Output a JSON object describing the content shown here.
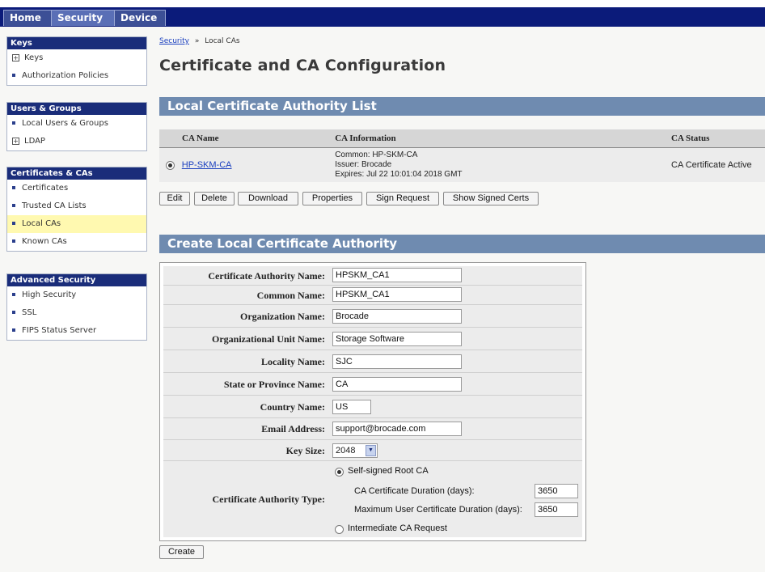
{
  "tabs": [
    {
      "label": "Home"
    },
    {
      "label": "Security"
    },
    {
      "label": "Device"
    }
  ],
  "sidebar": {
    "keys": {
      "heading": "Keys",
      "items": [
        {
          "label": "Keys",
          "marker": "plus"
        },
        {
          "label": "Authorization Policies",
          "marker": "bullet"
        }
      ]
    },
    "users_groups": {
      "heading": "Users & Groups",
      "items": [
        {
          "label": "Local Users & Groups",
          "marker": "bullet"
        },
        {
          "label": "LDAP",
          "marker": "plus"
        }
      ]
    },
    "certificates": {
      "heading": "Certificates & CAs",
      "items": [
        {
          "label": "Certificates",
          "marker": "bullet"
        },
        {
          "label": "Trusted CA Lists",
          "marker": "bullet"
        },
        {
          "label": "Local CAs",
          "marker": "bullet",
          "selected": true
        },
        {
          "label": "Known CAs",
          "marker": "bullet"
        }
      ]
    },
    "advanced": {
      "heading": "Advanced Security",
      "items": [
        {
          "label": "High Security",
          "marker": "bullet"
        },
        {
          "label": "SSL",
          "marker": "bullet"
        },
        {
          "label": "FIPS Status Server",
          "marker": "bullet"
        }
      ]
    }
  },
  "breadcrumb": {
    "link": "Security",
    "separator": "»",
    "current": "Local CAs"
  },
  "page_title": "Certificate and CA Configuration",
  "ca_list": {
    "heading": "Local Certificate Authority List",
    "columns": [
      "CA Name",
      "CA Information",
      "CA Status"
    ],
    "rows": [
      {
        "name": "HP-SKM-CA",
        "info_common": "Common: HP-SKM-CA",
        "info_issuer": "Issuer: Brocade",
        "info_expires": "Expires: Jul 22 10:01:04 2018 GMT",
        "status": "CA Certificate Active"
      }
    ],
    "buttons": [
      "Edit",
      "Delete",
      "Download",
      "Properties",
      "Sign Request",
      "Show Signed Certs"
    ]
  },
  "create_form": {
    "heading": "Create Local Certificate Authority",
    "fields": {
      "ca_name": {
        "label": "Certificate Authority Name:",
        "value": "HPSKM_CA1"
      },
      "common_name": {
        "label": "Common Name:",
        "value": "HPSKM_CA1"
      },
      "org_name": {
        "label": "Organization Name:",
        "value": "Brocade"
      },
      "org_unit": {
        "label": "Organizational Unit Name:",
        "value": "Storage Software"
      },
      "locality": {
        "label": "Locality Name:",
        "value": "SJC"
      },
      "state": {
        "label": "State or Province Name:",
        "value": "CA"
      },
      "country": {
        "label": "Country Name:",
        "value": "US"
      },
      "email": {
        "label": "Email Address:",
        "value": "support@brocade.com"
      },
      "key_size": {
        "label": "Key Size:",
        "value": "2048"
      }
    },
    "ca_type": {
      "label": "Certificate Authority Type:",
      "option_self_signed": "Self-signed Root CA",
      "ca_duration_label": "CA Certificate Duration (days):",
      "ca_duration_value": "3650",
      "user_duration_label": "Maximum User Certificate Duration (days):",
      "user_duration_value": "3650",
      "option_intermediate": "Intermediate CA Request"
    },
    "create_button": "Create"
  }
}
